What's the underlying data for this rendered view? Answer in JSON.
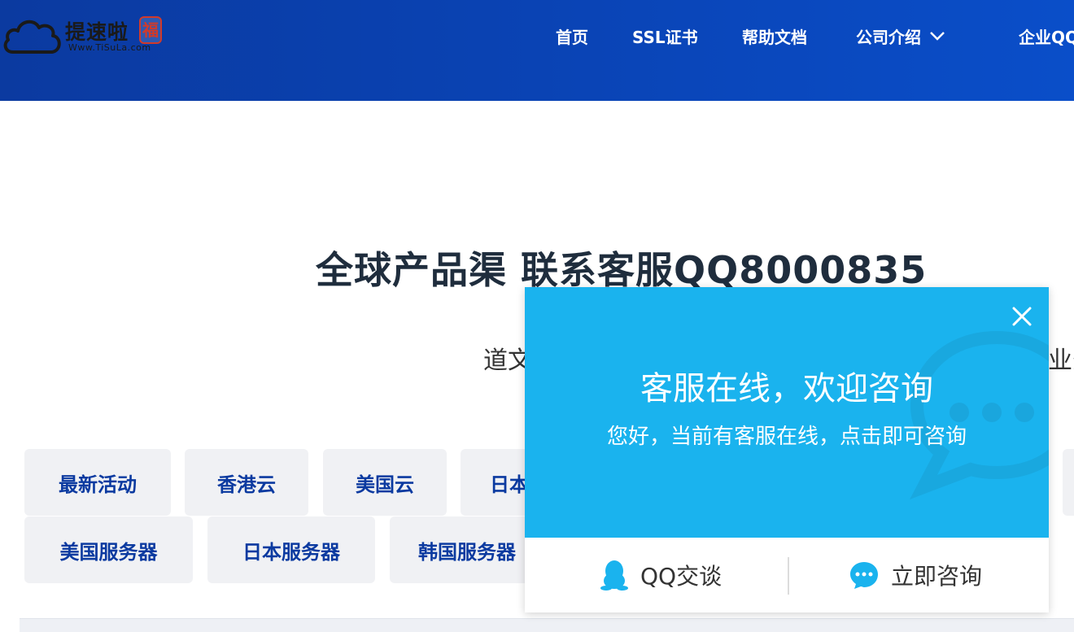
{
  "header": {
    "logo_text": "提速啦",
    "logo_url": "Www.TiSuLa.com",
    "logo_seal": "福"
  },
  "nav": {
    "items": [
      "首页",
      "SSL证书",
      "帮助文档",
      "公司介绍",
      "企业QQ"
    ]
  },
  "hero": {
    "title": "全球产品渠 联系客服QQ8000835",
    "subtitle_left": "道文",
    "subtitle_right": "业务"
  },
  "tabs": {
    "row1": [
      "最新活动",
      "香港云",
      "美国云",
      "日本"
    ],
    "row2": [
      "美国服务器",
      "日本服务器",
      "韩国服务器"
    ]
  },
  "popup": {
    "title": "客服在线，欢迎咨询",
    "description": "您好，当前有客服在线，点击即可咨询",
    "qq_button": "QQ交谈",
    "consult_button": "立即咨询"
  },
  "colors": {
    "header_bg": "#0a43b4",
    "popup_bg": "#1ab3ee",
    "tab_text": "#0b3aa0",
    "title_text": "#1f2d3d"
  }
}
